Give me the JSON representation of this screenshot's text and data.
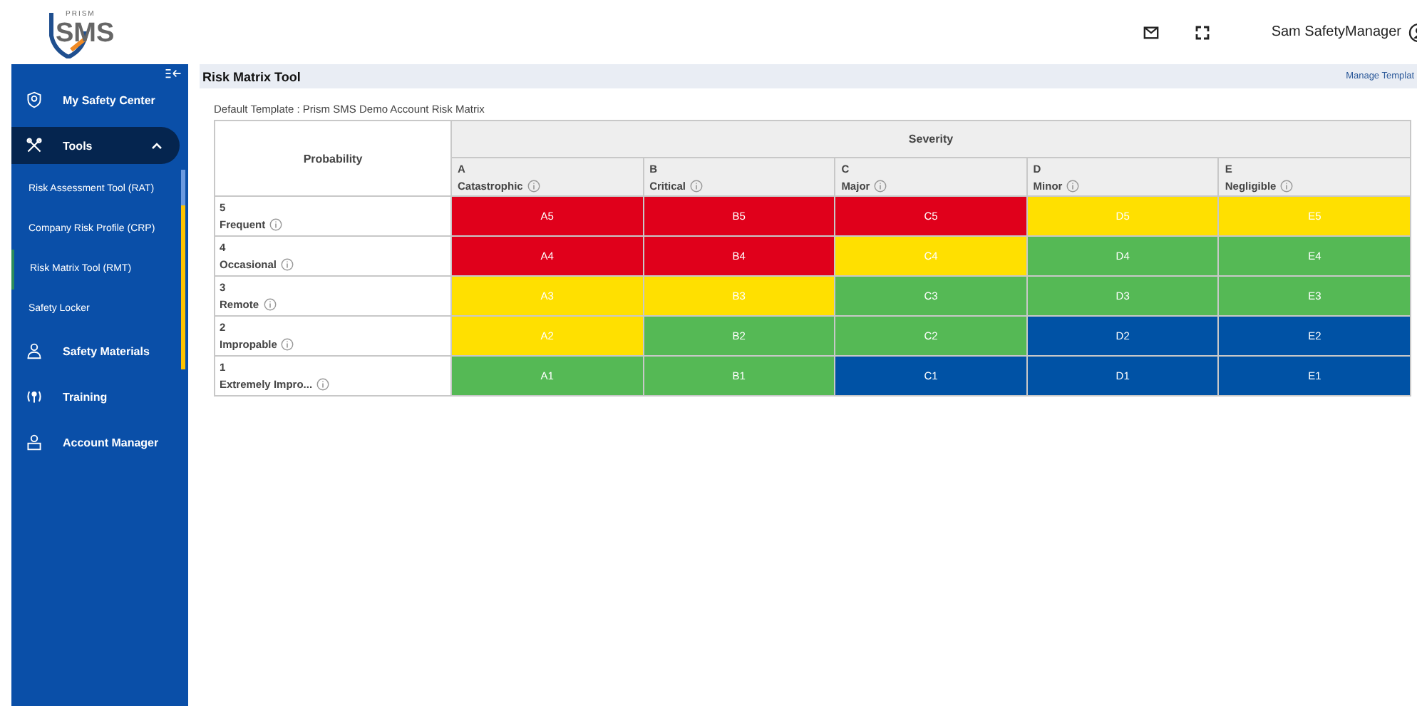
{
  "header": {
    "logo_small": "PRISM",
    "logo": "SMS",
    "user": "Sam SafetyManager"
  },
  "sidebar": {
    "items": [
      {
        "label": "My Safety Center",
        "selected": false
      },
      {
        "label": "Tools",
        "expanded": true,
        "selected": true,
        "children": [
          {
            "label": "Risk Assessment Tool (RAT)",
            "selected": false
          },
          {
            "label": "Company Risk Profile (CRP)",
            "selected": false
          },
          {
            "label": "Risk Matrix Tool (RMT)",
            "selected": true
          },
          {
            "label": "Safety Locker",
            "selected": false
          }
        ]
      },
      {
        "label": "Safety Materials",
        "selected": false
      },
      {
        "label": "Training",
        "selected": false
      },
      {
        "label": "Account Manager",
        "selected": false
      }
    ]
  },
  "page": {
    "title": "Risk Matrix Tool",
    "link": "Manage Templat",
    "template_label": "Default Template : Prism SMS Demo Account Risk Matrix"
  },
  "matrix": {
    "probability_heading": "Probability",
    "severity_heading": "Severity",
    "columns": [
      {
        "letter": "A",
        "name": "Catastrophic"
      },
      {
        "letter": "B",
        "name": "Critical"
      },
      {
        "letter": "C",
        "name": "Major"
      },
      {
        "letter": "D",
        "name": "Minor"
      },
      {
        "letter": "E",
        "name": "Negligible"
      }
    ],
    "rows": [
      {
        "number": "5",
        "name": "Frequent",
        "cells": [
          {
            "text": "A5",
            "color": "#e0001b"
          },
          {
            "text": "B5",
            "color": "#e0001b"
          },
          {
            "text": "C5",
            "color": "#e0001b"
          },
          {
            "text": "D5",
            "color": "#ffe000"
          },
          {
            "text": "E5",
            "color": "#ffe000"
          }
        ]
      },
      {
        "number": "4",
        "name": "Occasional",
        "cells": [
          {
            "text": "A4",
            "color": "#e0001b"
          },
          {
            "text": "B4",
            "color": "#e0001b"
          },
          {
            "text": "C4",
            "color": "#ffe000"
          },
          {
            "text": "D4",
            "color": "#55b955"
          },
          {
            "text": "E4",
            "color": "#55b955"
          }
        ]
      },
      {
        "number": "3",
        "name": "Remote",
        "cells": [
          {
            "text": "A3",
            "color": "#ffe000"
          },
          {
            "text": "B3",
            "color": "#ffe000"
          },
          {
            "text": "C3",
            "color": "#55b955"
          },
          {
            "text": "D3",
            "color": "#55b955"
          },
          {
            "text": "E3",
            "color": "#55b955"
          }
        ]
      },
      {
        "number": "2",
        "name": "Impropable",
        "cells": [
          {
            "text": "A2",
            "color": "#ffe000"
          },
          {
            "text": "B2",
            "color": "#55b955"
          },
          {
            "text": "C2",
            "color": "#55b955"
          },
          {
            "text": "D2",
            "color": "#0052a5"
          },
          {
            "text": "E2",
            "color": "#0052a5"
          }
        ]
      },
      {
        "number": "1",
        "name": "Extremely Impro...",
        "cells": [
          {
            "text": "A1",
            "color": "#55b955"
          },
          {
            "text": "B1",
            "color": "#55b955"
          },
          {
            "text": "C1",
            "color": "#0052a5"
          },
          {
            "text": "D1",
            "color": "#0052a5"
          },
          {
            "text": "E1",
            "color": "#0052a5"
          }
        ]
      }
    ]
  }
}
